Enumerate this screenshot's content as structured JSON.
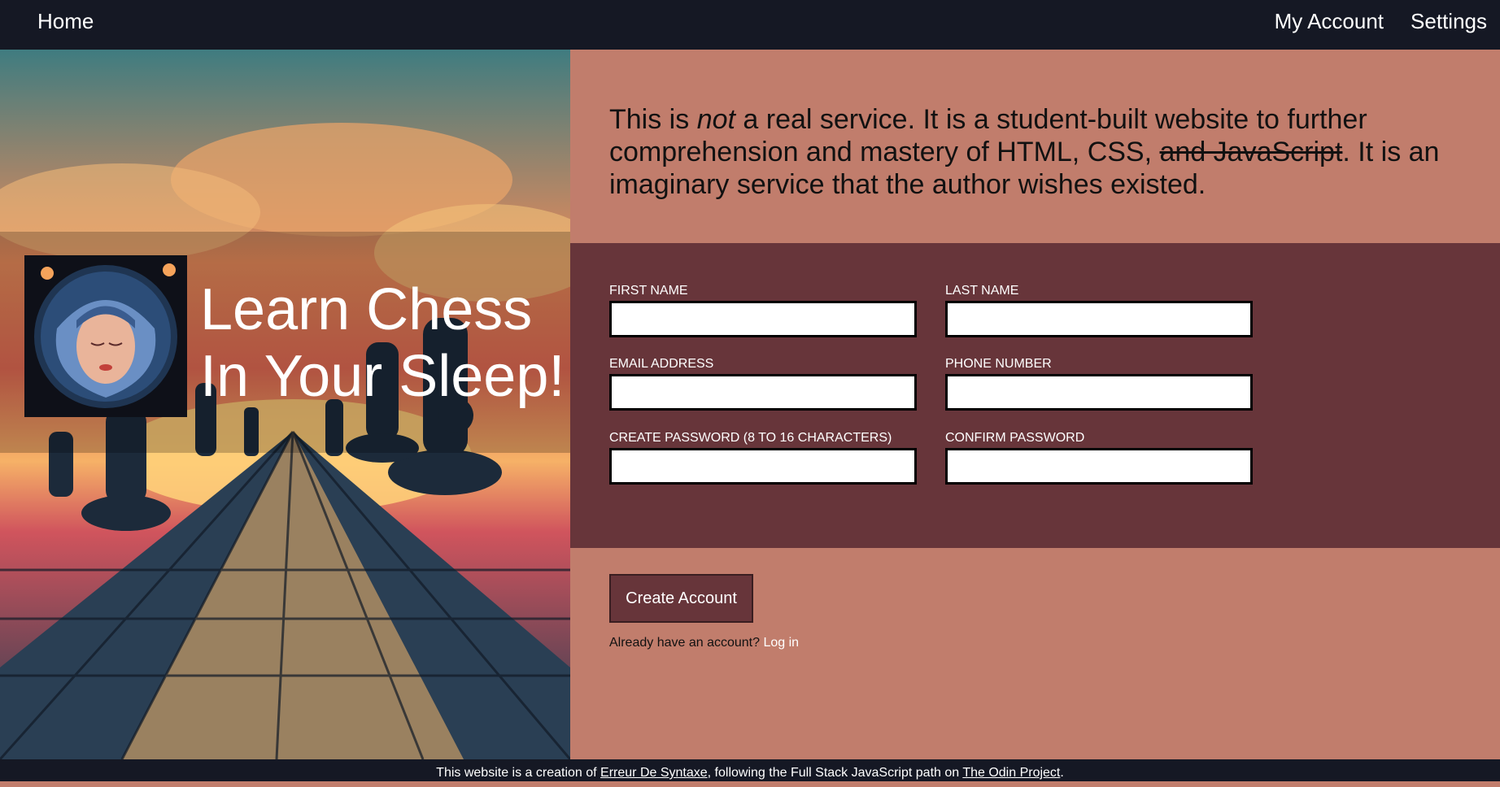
{
  "nav": {
    "home": "Home",
    "account": "My Account",
    "settings": "Settings"
  },
  "hero": {
    "title_line1": "Learn Chess",
    "title_line2": "In Your Sleep!"
  },
  "intro": {
    "before_em": "This is ",
    "em": "not",
    "after_em": " a real service. It is a student-built website to further comprehension and mastery of HTML, CSS, ",
    "struck": "and JavaScript",
    "end": ". It is an imaginary service that the author wishes existed."
  },
  "form": {
    "first_name_label": "FIRST NAME",
    "last_name_label": "LAST NAME",
    "email_label": "EMAIL ADDRESS",
    "phone_label": "PHONE NUMBER",
    "password_label": "CREATE PASSWORD (8 TO 16 CHARACTERS)",
    "confirm_label": "CONFIRM PASSWORD"
  },
  "actions": {
    "create_button": "Create Account",
    "login_prompt": "Already have an account?",
    "login_link": "Log in"
  },
  "footer": {
    "prefix": "This website is a creation of ",
    "author": "Erreur De Syntaxe",
    "middle": ", following the Full Stack JavaScript path on ",
    "project": "The Odin Project",
    "suffix": "."
  },
  "colors": {
    "nav_bg": "#151824",
    "panel_light": "#c17d6c",
    "panel_dark": "#67353a",
    "button": "#67353a"
  },
  "icons": {
    "hero_art": "chessboard-illustration",
    "avatar": "sleeping-woman-avatar"
  }
}
